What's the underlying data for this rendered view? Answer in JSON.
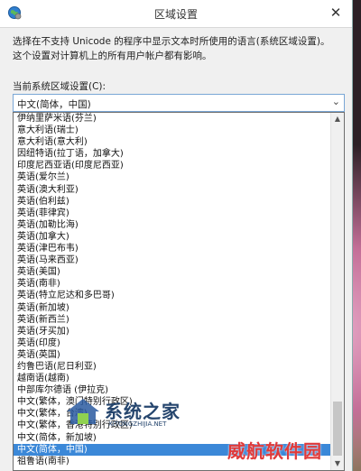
{
  "window": {
    "title": "区域设置",
    "close_glyph": "✕"
  },
  "description": "选择在不支持 Unicode 的程序中显示文本时所使用的语言(系统区域设置)。这个设置对计算机上的所有用户帐户都有影响。",
  "locale_field": {
    "label": "当前系统区域设置(C):",
    "selected_value": "中文(简体，中国)",
    "chevron_icon": "chevron-down-icon"
  },
  "dropdown_options": [
    "伊纳里萨米语(芬兰)",
    "意大利语(瑞士)",
    "意大利语(意大利)",
    "因纽特语(拉丁语，加拿大)",
    "印度尼西亚语(印度尼西亚)",
    "英语(爱尔兰)",
    "英语(澳大利亚)",
    "英语(伯利兹)",
    "英语(菲律宾)",
    "英语(加勒比海)",
    "英语(加拿大)",
    "英语(津巴布韦)",
    "英语(马来西亚)",
    "英语(美国)",
    "英语(南非)",
    "英语(特立尼达和多巴哥)",
    "英语(新加坡)",
    "英语(新西兰)",
    "英语(牙买加)",
    "英语(印度)",
    "英语(英国)",
    "约鲁巴语(尼日利亚)",
    "越南语(越南)",
    "中部库尔德语 (伊拉克)",
    "中文(繁体，澳门特别行政区)",
    "中文(繁体，台湾)",
    "中文(繁体，香港特别行政区)",
    "中文(简体，新加坡)",
    "中文(简体，中国)",
    "祖鲁语(南非)"
  ],
  "selected_index": 28,
  "scrollbar": {
    "up_glyph": "▲",
    "down_glyph": "▼"
  },
  "watermark": {
    "site_name": "系统之家",
    "site_url": "XITONGZHIJIA.NET",
    "stamp": "威航软件园"
  },
  "colors": {
    "selection": "#3b88d8",
    "stamp": "#e03a3a"
  }
}
